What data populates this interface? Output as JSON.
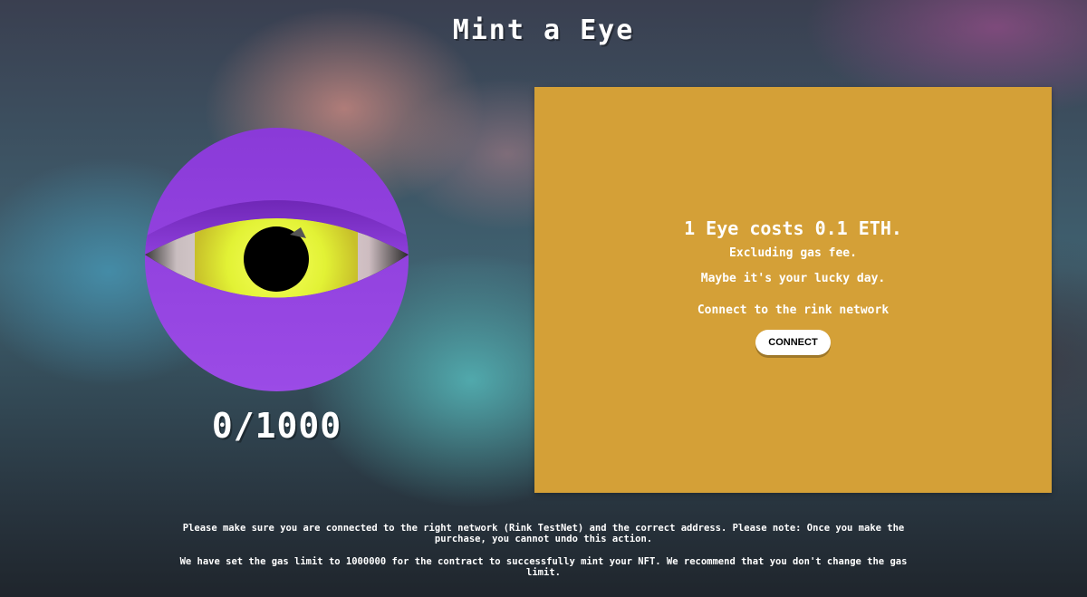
{
  "header": {
    "title": "Mint a Eye"
  },
  "nft": {
    "image_icon": "eye-icon",
    "minted_count": "0/1000"
  },
  "mint_panel": {
    "price_text": "1 Eye costs 0.1 ETH.",
    "gas_note": "Excluding gas fee.",
    "luck_note": "Maybe it's your lucky day.",
    "network_prompt": "Connect to the rink network",
    "connect_label": "CONNECT",
    "panel_color": "#d4a037"
  },
  "footer": {
    "network_note": "Please make sure you are connected to the right network (Rink TestNet) and the correct address. Please note: Once you make the purchase, you cannot undo this action.",
    "gas_limit_note": "We have set the gas limit to 1000000 for the contract to successfully mint your NFT. We recommend that you don't change the gas limit."
  }
}
